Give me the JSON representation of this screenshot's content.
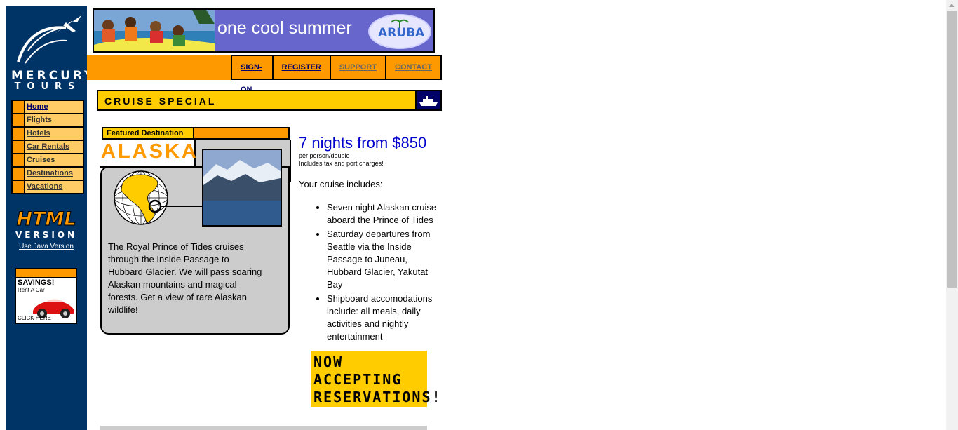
{
  "logo": {
    "line1": "MERCURY",
    "line2": "TOURS"
  },
  "sidebar": {
    "nav": [
      {
        "label": "Home"
      },
      {
        "label": "Flights"
      },
      {
        "label": "Hotels"
      },
      {
        "label": "Car Rentals"
      },
      {
        "label": "Cruises"
      },
      {
        "label": "Destinations"
      },
      {
        "label": "Vacations"
      }
    ],
    "html_version": {
      "line1": "HTML",
      "line2": "VERSION",
      "link": "Use Java Version"
    },
    "savings_ad": {
      "title": "SAVINGS!",
      "sub": "Rent A Car",
      "cta": "CLICK HERE"
    }
  },
  "banner": {
    "text": "one cool summer",
    "brand": "ARUBA"
  },
  "topnav": [
    {
      "label": "SIGN-ON"
    },
    {
      "label": "REGISTER"
    },
    {
      "label": "SUPPORT"
    },
    {
      "label": "CONTACT"
    }
  ],
  "cruise": {
    "title": "CRUISE SPECIAL"
  },
  "featured": {
    "label": "Featured Destination",
    "destination": "ALASKA",
    "description": "The Royal Prince of Tides cruises through the Inside Passage to Hubbard Glacier. We will pass soaring Alaskan mountains and magical forests. Get a view of rare Alaskan wildlife!"
  },
  "offer": {
    "price": "7 nights from $850",
    "per_person": "per person/double",
    "taxes": "Includes tax and port charges!",
    "includes_heading": "Your cruise includes:",
    "includes": [
      "Seven night Alaskan cruise aboard the Prince of Tides",
      "Saturday departures from Seattle via the Inside Passage to Juneau, Hubbard Glacier, Yakutat Bay",
      "Shipboard accomodations include: all meals, daily activities and nightly entertainment"
    ],
    "now_accepting": [
      "NOW",
      "ACCEPTING",
      "RESERVATIONS!"
    ]
  },
  "colors": {
    "navy": "#003366",
    "orange": "#ff9900",
    "gold": "#ffcc00",
    "link": "#000066",
    "price": "#0000cc"
  }
}
